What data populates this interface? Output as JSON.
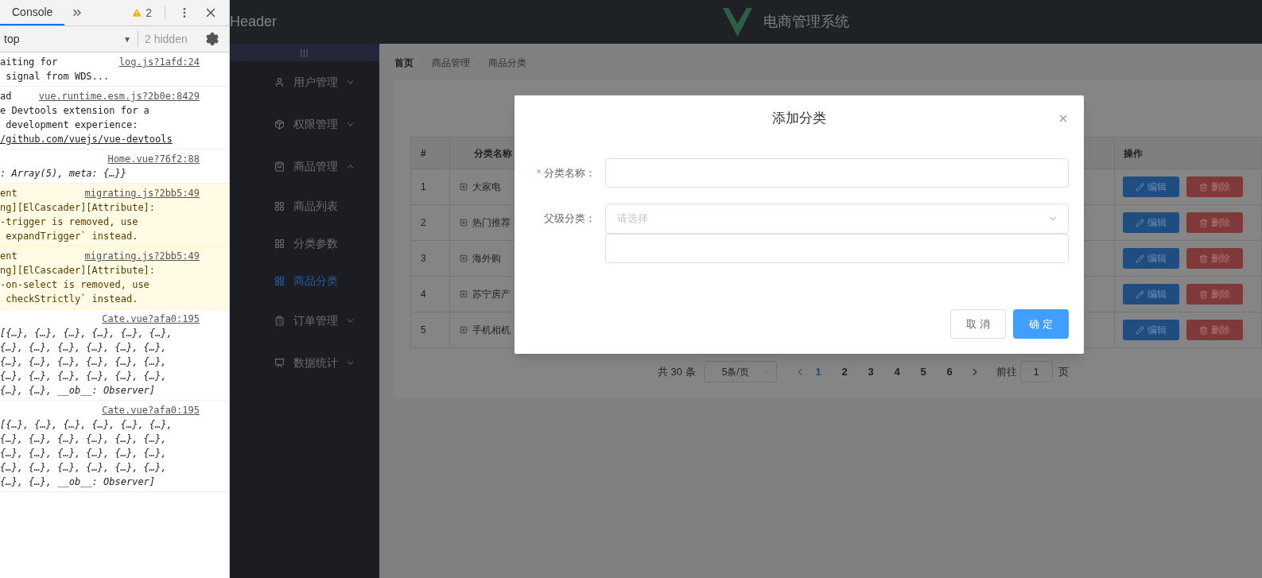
{
  "devtools": {
    "tabs": [
      {
        "label": "Console",
        "selected": true
      }
    ],
    "warning_count": "2",
    "context": "top",
    "context_arrow": "▼",
    "hidden_label": "2 hidden",
    "messages": [
      {
        "kind": "info",
        "head": "aiting for",
        "source": "log.js?1afd:24",
        "lines": [
          " signal from WDS..."
        ]
      },
      {
        "kind": "info",
        "head": "ad",
        "source": "vue.runtime.esm.js?2b0e:8429",
        "lines": [
          "e Devtools extension for a",
          " development experience:"
        ],
        "link": "/github.com/vuejs/vue-devtools"
      },
      {
        "kind": "info",
        "source": "Home.vue?76f2:88",
        "italic": true,
        "lines": [
          ": Array(5), meta: {…}}"
        ]
      },
      {
        "kind": "warning",
        "head": "ent",
        "source": "migrating.js?2bb5:49",
        "lines": [
          "ng][ElCascader][Attribute]:",
          "-trigger is removed, use",
          " expandTrigger` instead."
        ]
      },
      {
        "kind": "warning",
        "head": "ent",
        "source": "migrating.js?2bb5:49",
        "lines": [
          "ng][ElCascader][Attribute]:",
          "-on-select is removed, use",
          " checkStrictly` instead."
        ]
      },
      {
        "kind": "info",
        "source": "Cate.vue?afa0:195",
        "italic": true,
        "lines": [
          "[{…}, {…}, {…}, {…}, {…}, {…},",
          "{…}, {…}, {…}, {…}, {…}, {…},",
          "{…}, {…}, {…}, {…}, {…}, {…},",
          "{…}, {…}, {…}, {…}, {…}, {…},",
          "{…}, {…}, __ob__: Observer]"
        ]
      },
      {
        "kind": "info",
        "source": "Cate.vue?afa0:195",
        "italic": true,
        "lines": [
          "[{…}, {…}, {…}, {…}, {…}, {…},",
          "{…}, {…}, {…}, {…}, {…}, {…},",
          "{…}, {…}, {…}, {…}, {…}, {…},",
          "{…}, {…}, {…}, {…}, {…}, {…},",
          "{…}, {…}, __ob__: Observer]"
        ]
      }
    ]
  },
  "header": {
    "title": "Header",
    "brand": "电商管理系统"
  },
  "sidebar": {
    "toggle": "|||",
    "items": [
      {
        "kind": "user",
        "label": "用户管理",
        "expanded": false
      },
      {
        "kind": "rights",
        "label": "权限管理",
        "expanded": false
      },
      {
        "kind": "goods",
        "label": "商品管理",
        "expanded": true,
        "children": [
          {
            "kind": "grid",
            "label": "商品列表",
            "selected": false
          },
          {
            "kind": "grid",
            "label": "分类参数",
            "selected": false
          },
          {
            "kind": "grid",
            "label": "商品分类",
            "selected": true
          }
        ]
      },
      {
        "kind": "orders",
        "label": "订单管理",
        "expanded": false
      },
      {
        "kind": "reports",
        "label": "数据统计",
        "expanded": false
      }
    ]
  },
  "breadcrumb": [
    {
      "label": "首页",
      "current": false
    },
    {
      "label": "商品管理",
      "current": true
    },
    {
      "label": "商品分类",
      "current": true
    }
  ],
  "table": {
    "columns": [
      "#",
      "分类名称",
      "操作"
    ],
    "rows": [
      {
        "index": "1",
        "name": "大家电",
        "actions": [
          "编辑",
          "删除"
        ]
      },
      {
        "index": "2",
        "name": "热门推荐",
        "actions": [
          "编辑",
          "删除"
        ]
      },
      {
        "index": "3",
        "name": "海外购",
        "actions": [
          "编辑",
          "删除"
        ]
      },
      {
        "index": "4",
        "name": "苏宁房产",
        "actions": [
          "编辑",
          "删除"
        ]
      },
      {
        "index": "5",
        "name": "手机相机",
        "actions": [
          "编辑",
          "删除"
        ]
      }
    ]
  },
  "pagination": {
    "total": "共 30 条",
    "page_size": "5条/页",
    "pages": [
      {
        "label": "1",
        "selected": true
      },
      {
        "label": "2",
        "selected": false
      },
      {
        "label": "3",
        "selected": false
      },
      {
        "label": "4",
        "selected": false
      },
      {
        "label": "5",
        "selected": false
      },
      {
        "label": "6",
        "selected": false
      }
    ],
    "jump_label": "前往",
    "jump_value": "1",
    "jump_suffix": "页"
  },
  "dialog": {
    "title": "添加分类",
    "required_mark": "*",
    "fields": [
      {
        "kind": "text",
        "label": "分类名称：",
        "required": true
      },
      {
        "kind": "select",
        "label": "父级分类：",
        "required": false,
        "placeholder": "请选择",
        "open": true
      }
    ],
    "buttons": [
      {
        "kind": "default",
        "label": "取 消"
      },
      {
        "kind": "primary",
        "label": "确 定"
      }
    ]
  }
}
